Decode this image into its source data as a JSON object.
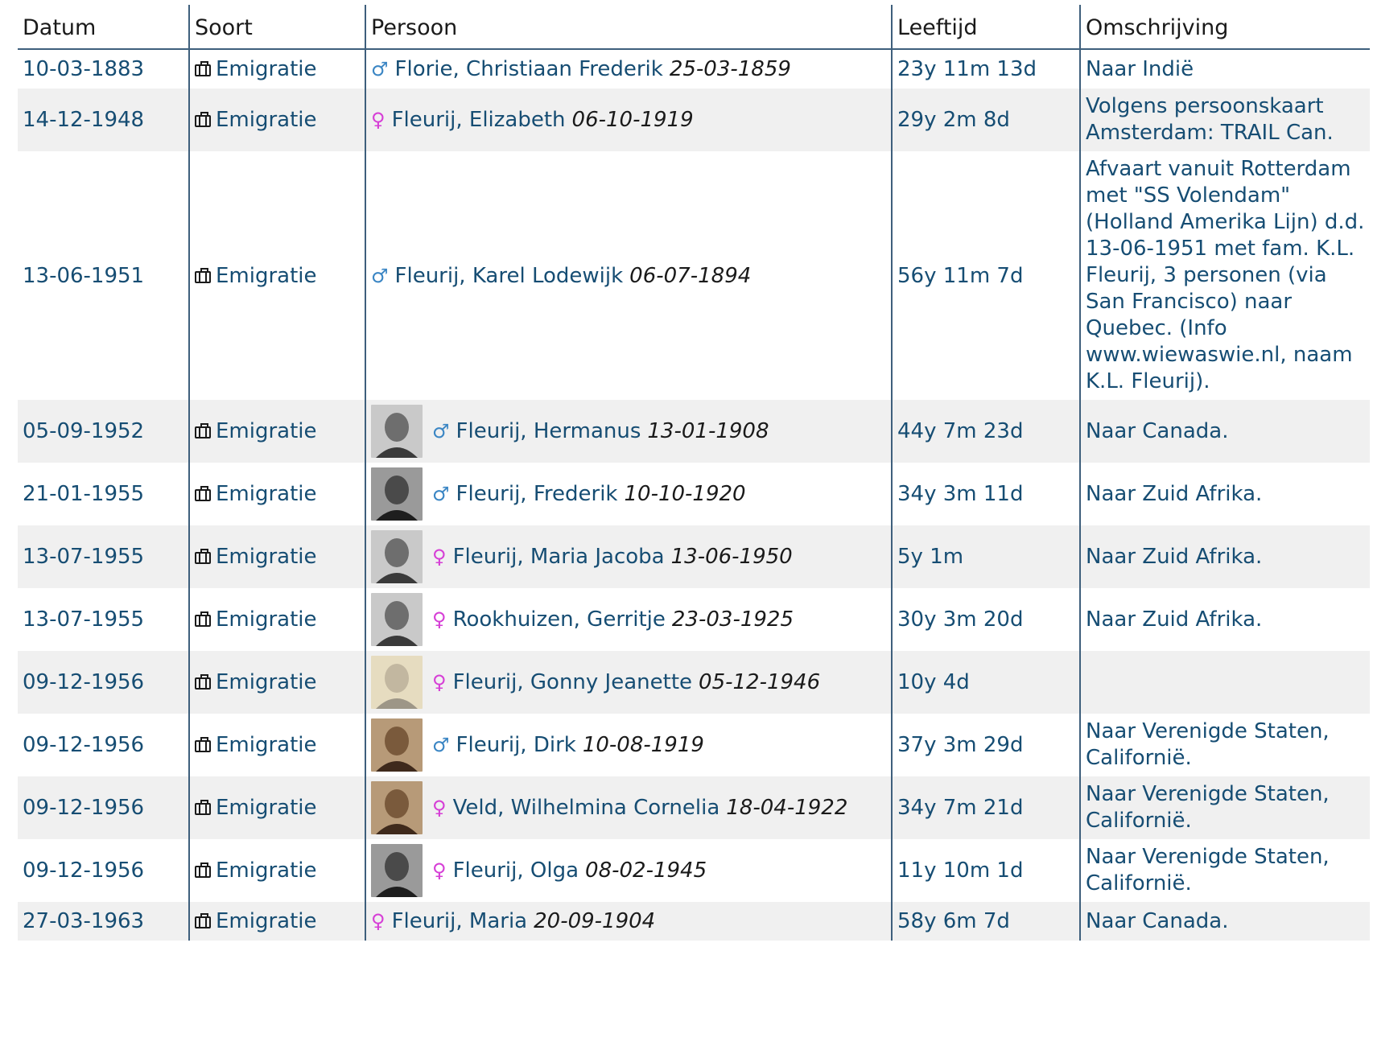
{
  "headers": {
    "date": "Datum",
    "type": "Soort",
    "person": "Persoon",
    "age": "Leeftijd",
    "desc": "Omschrijving"
  },
  "colors": {
    "link": "#164d73",
    "male": "#3b86c4",
    "female": "#d63fd6",
    "divider": "#3e5f7c",
    "row_alt": "#f0f0f0"
  },
  "rows": [
    {
      "date": "10-03-1883",
      "type": "Emigratie",
      "sex": "m",
      "photo": null,
      "name": "Florie, Christiaan Frederik",
      "birth": "25-03-1859",
      "age": "23y 11m 13d",
      "desc": "Naar Indië"
    },
    {
      "date": "14-12-1948",
      "type": "Emigratie",
      "sex": "f",
      "photo": null,
      "name": "Fleurij, Elizabeth",
      "birth": "06-10-1919",
      "age": "29y 2m 8d",
      "desc": "Volgens persoonskaart Amsterdam: TRAIL Can."
    },
    {
      "date": "13-06-1951",
      "type": "Emigratie",
      "sex": "m",
      "photo": null,
      "name": "Fleurij, Karel Lodewijk",
      "birth": "06-07-1894",
      "age": "56y 11m 7d",
      "desc": "Afvaart vanuit Rotterdam met \"SS Volendam\" (Holland Amerika Lijn) d.d. 13-06-1951 met fam. K.L. Fleurij, 3 personen (via San Francisco) naar Quebec. (Info www.wiewaswie.nl, naam K.L. Fleurij)."
    },
    {
      "date": "05-09-1952",
      "type": "Emigratie",
      "sex": "m",
      "photo": "gray",
      "name": "Fleurij, Hermanus",
      "birth": "13-01-1908",
      "age": "44y 7m 23d",
      "desc": "Naar Canada."
    },
    {
      "date": "21-01-1955",
      "type": "Emigratie",
      "sex": "m",
      "photo": "dark",
      "name": "Fleurij, Frederik",
      "birth": "10-10-1920",
      "age": "34y 3m 11d",
      "desc": "Naar Zuid Afrika."
    },
    {
      "date": "13-07-1955",
      "type": "Emigratie",
      "sex": "f",
      "photo": "gray",
      "name": "Fleurij, Maria Jacoba",
      "birth": "13-06-1950",
      "age": "5y 1m",
      "desc": "Naar Zuid Afrika."
    },
    {
      "date": "13-07-1955",
      "type": "Emigratie",
      "sex": "f",
      "photo": "gray",
      "name": "Rookhuizen, Gerritje",
      "birth": "23-03-1925",
      "age": "30y 3m 20d",
      "desc": "Naar Zuid Afrika."
    },
    {
      "date": "09-12-1956",
      "type": "Emigratie",
      "sex": "f",
      "photo": "pale",
      "name": "Fleurij, Gonny Jeanette",
      "birth": "05-12-1946",
      "age": "10y 4d",
      "desc": ""
    },
    {
      "date": "09-12-1956",
      "type": "Emigratie",
      "sex": "m",
      "photo": "sepia",
      "name": "Fleurij, Dirk",
      "birth": "10-08-1919",
      "age": "37y 3m 29d",
      "desc": "Naar Verenigde Staten, Californië."
    },
    {
      "date": "09-12-1956",
      "type": "Emigratie",
      "sex": "f",
      "photo": "sepia",
      "name": "Veld, Wilhelmina Cornelia",
      "birth": "18-04-1922",
      "age": "34y 7m 21d",
      "desc": "Naar Verenigde Staten, Californië."
    },
    {
      "date": "09-12-1956",
      "type": "Emigratie",
      "sex": "f",
      "photo": "dark",
      "name": "Fleurij, Olga",
      "birth": "08-02-1945",
      "age": "11y 10m 1d",
      "desc": "Naar Verenigde Staten, Californië."
    },
    {
      "date": "27-03-1963",
      "type": "Emigratie",
      "sex": "f",
      "photo": null,
      "name": "Fleurij, Maria",
      "birth": "20-09-1904",
      "age": "58y 6m 7d",
      "desc": "Naar Canada."
    }
  ]
}
